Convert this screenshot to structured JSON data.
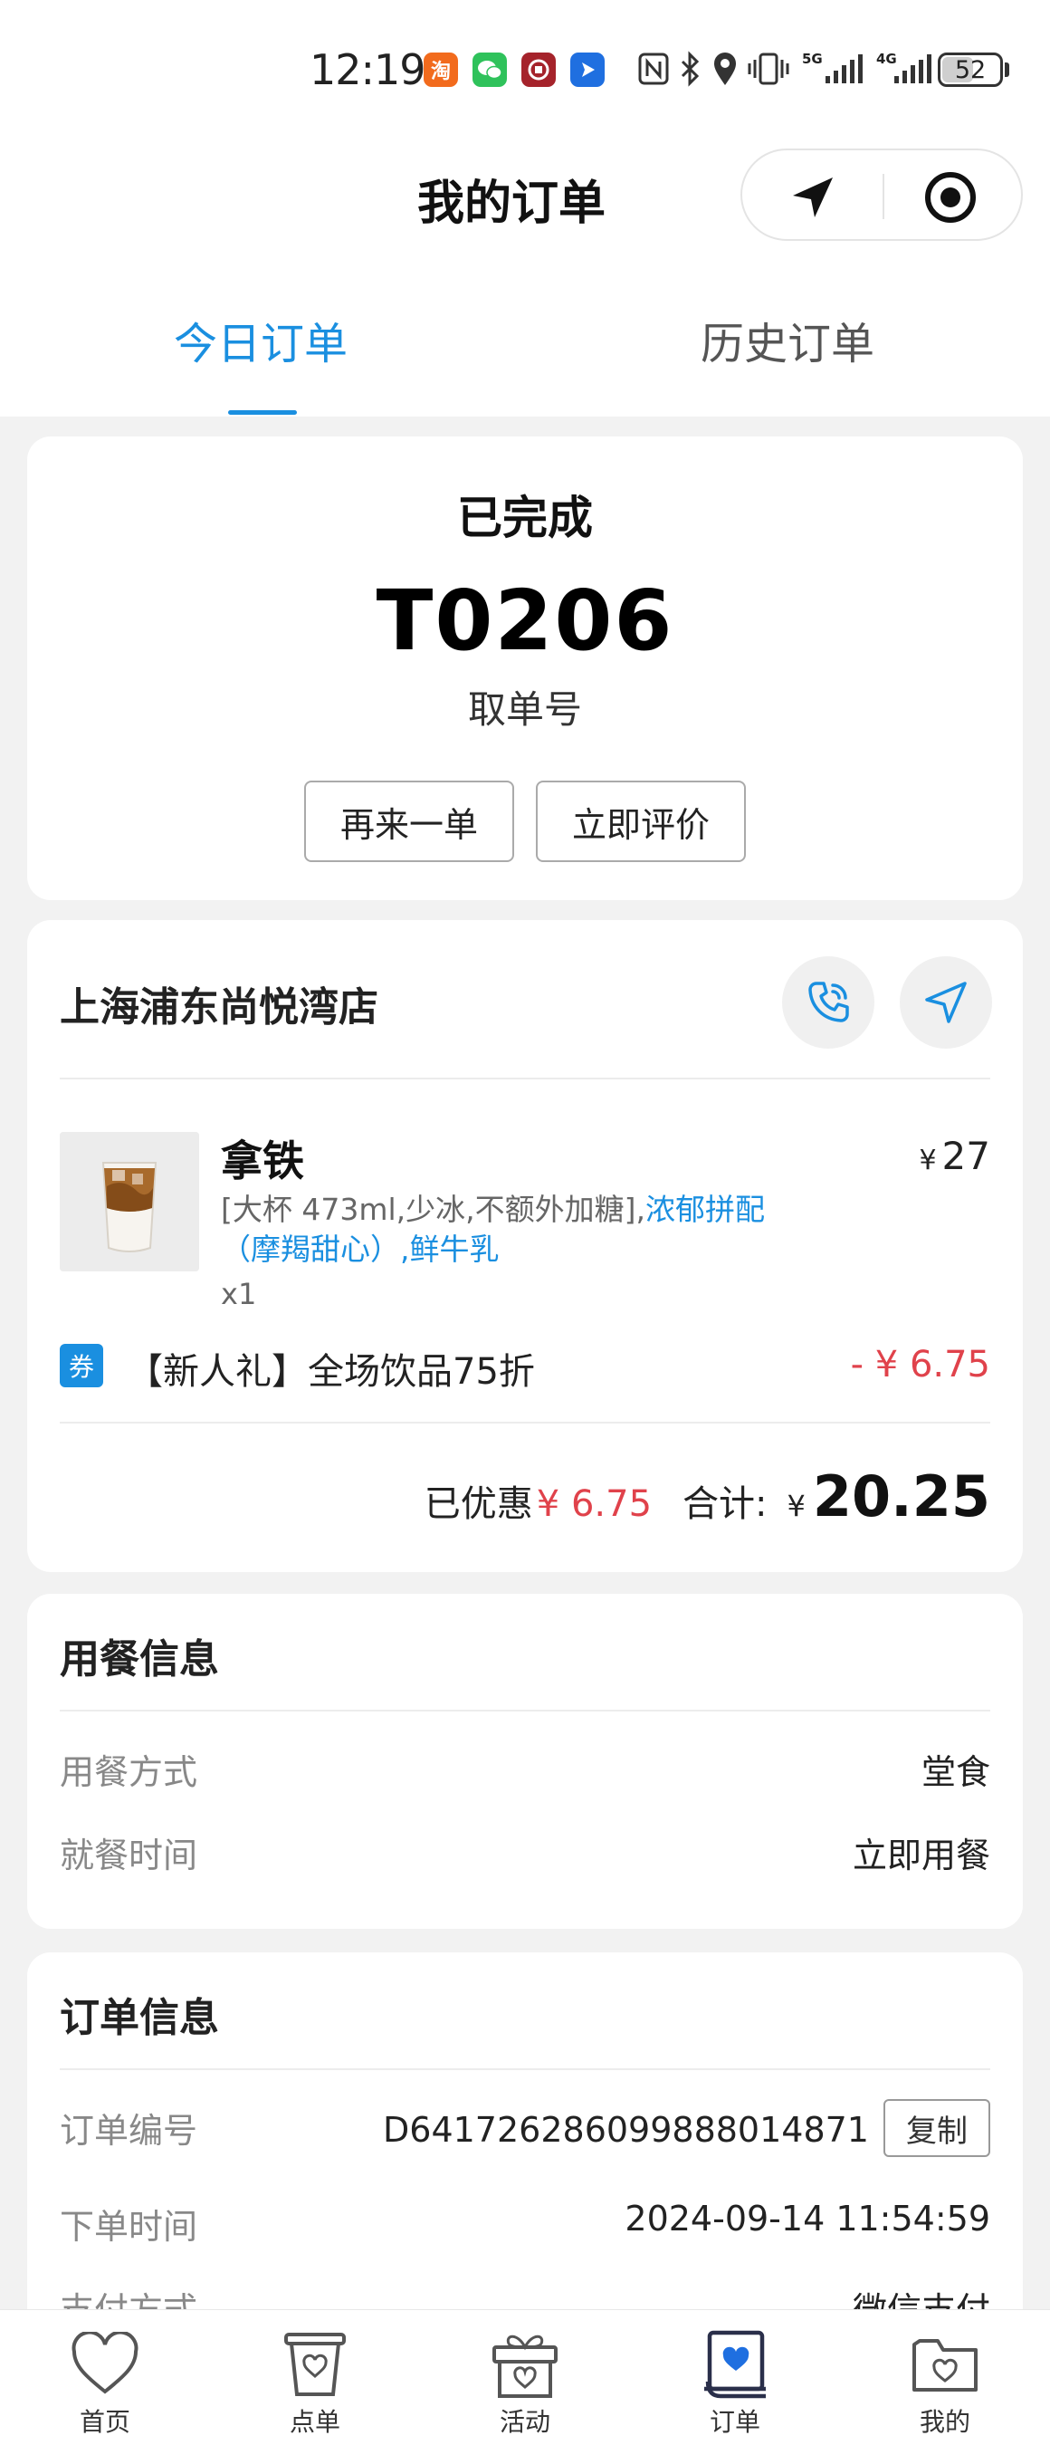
{
  "status_bar": {
    "time": "12:19",
    "app_icons": [
      "taobao-icon",
      "wechat-icon",
      "bank-icon",
      "messenger-icon"
    ],
    "signal_1_label": "5G",
    "signal_2_label": "4G",
    "battery": "52"
  },
  "header": {
    "title": "我的订单"
  },
  "tabs": [
    {
      "label": "今日订单",
      "active": true
    },
    {
      "label": "历史订单",
      "active": false
    }
  ],
  "order_status": {
    "status": "已完成",
    "pickup_number": "T0206",
    "pickup_label": "取单号",
    "reorder_label": "再来一单",
    "review_label": "立即评价"
  },
  "store": {
    "name": "上海浦东尚悦湾店"
  },
  "product": {
    "name": "拿铁",
    "price_symbol": "¥",
    "price": "27",
    "spec_plain": "[大杯 473ml,少冰,不额外加糖],",
    "spec_highlight": "浓郁拼配（摩羯甜心）,鲜牛乳",
    "quantity": "x1"
  },
  "coupon": {
    "badge": "券",
    "name": "【新人礼】全场饮品75折",
    "discount": "- ¥ 6.75"
  },
  "summary": {
    "saved_label": "已优惠",
    "saved_amount": "¥ 6.75",
    "total_label": "合计:",
    "total_symbol": "¥",
    "total": "20.25"
  },
  "dining_info": {
    "title": "用餐信息",
    "rows": [
      {
        "label": "用餐方式",
        "value": "堂食"
      },
      {
        "label": "就餐时间",
        "value": "立即用餐"
      }
    ]
  },
  "order_info": {
    "title": "订单信息",
    "order_number_label": "订单编号",
    "order_number": "D641726286099888014871",
    "copy_label": "复制",
    "order_time_label": "下单时间",
    "order_time": "2024-09-14 11:54:59",
    "payment_label": "支付方式",
    "payment_value": "微信支付"
  },
  "bottom_nav": [
    {
      "label": "首页",
      "icon": "heart-icon"
    },
    {
      "label": "点单",
      "icon": "cup-icon"
    },
    {
      "label": "活动",
      "icon": "gift-icon"
    },
    {
      "label": "订单",
      "icon": "order-icon",
      "active": true
    },
    {
      "label": "我的",
      "icon": "folder-heart-icon"
    }
  ],
  "colors": {
    "accent": "#1a8fe0",
    "price_red": "#e0424b",
    "background": "#f2f2f2"
  }
}
